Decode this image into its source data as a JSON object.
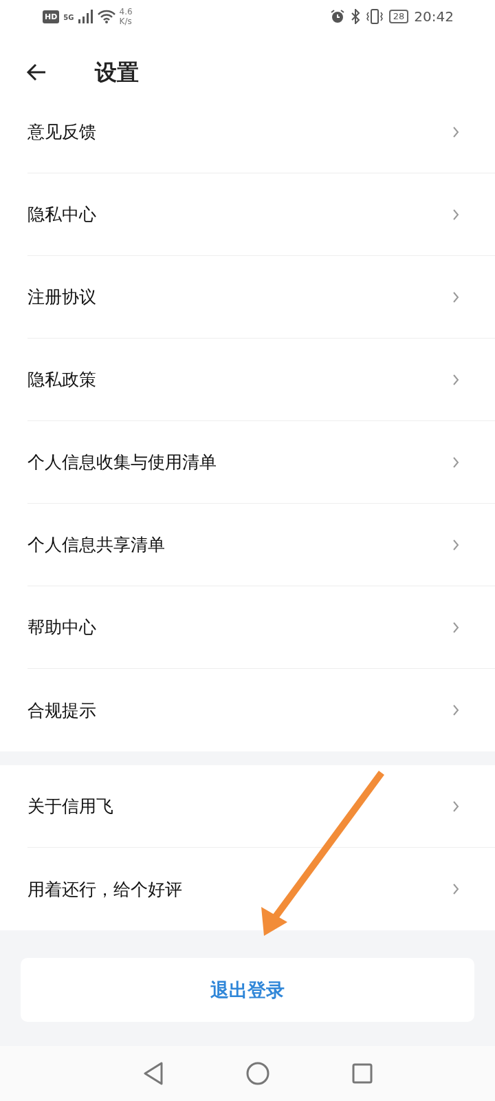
{
  "status_bar": {
    "hd": "HD",
    "network": "5G",
    "speed_value": "4.6",
    "speed_unit": "K/s",
    "battery": "28",
    "time": "20:42"
  },
  "header": {
    "title": "设置"
  },
  "groups": [
    {
      "items": [
        {
          "label": "意见反馈"
        },
        {
          "label": "隐私中心"
        },
        {
          "label": "注册协议"
        },
        {
          "label": "隐私政策"
        },
        {
          "label": "个人信息收集与使用清单"
        },
        {
          "label": "个人信息共享清单"
        },
        {
          "label": "帮助中心"
        },
        {
          "label": "合规提示"
        }
      ]
    },
    {
      "items": [
        {
          "label": "关于信用飞"
        },
        {
          "label": "用着还行，给个好评"
        }
      ]
    }
  ],
  "logout_button": "退出登录"
}
